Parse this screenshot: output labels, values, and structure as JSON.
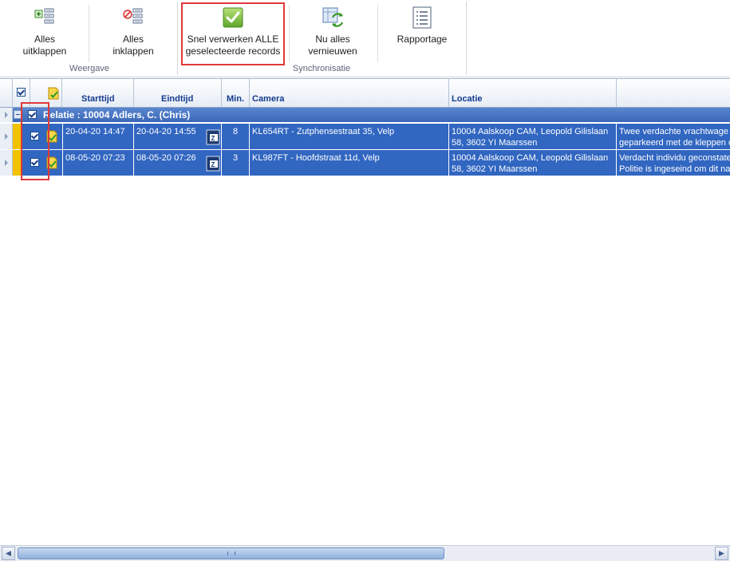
{
  "ribbon": {
    "buttons": {
      "expand_all": "Alles\nuitklappen",
      "collapse_all": "Alles\ninklappen",
      "process_all": "Snel verwerken ALLE\ngeselecteerde records",
      "refresh_all": "Nu alles\nvernieuwen",
      "report": "Rapportage"
    },
    "groups": {
      "view": "Weergave",
      "sync": "Synchronisatie"
    }
  },
  "grid": {
    "columns": {
      "start": "Starttijd",
      "end": "Eindtijd",
      "min": "Min.",
      "camera": "Camera",
      "location": "Locatie"
    },
    "group": {
      "label": "Relatie : 10004 Adlers, C. (Chris)"
    },
    "rows": [
      {
        "start": "20-04-20 14:47",
        "end": "20-04-20 14:55",
        "min": "8",
        "camera": "KL654RT - Zutphensestraat 35, Velp",
        "location_line1": "10004 Aalskoop CAM, Leopold Gilislaan",
        "location_line2": "58, 3602 YI  Maarssen",
        "desc_line1": "Twee verdachte vrachtwage",
        "desc_line2": "geparkeerd met de kleppen o"
      },
      {
        "start": "08-05-20 07:23",
        "end": "08-05-20 07:26",
        "min": "3",
        "camera": "KL987FT - Hoofdstraat 11d, Velp",
        "location_line1": "10004 Aalskoop CAM, Leopold Gilislaan",
        "location_line2": "58, 3602 YI  Maarssen",
        "desc_line1": "Verdacht individu geconstate",
        "desc_line2": "Politie is ingeseind om dit nad"
      }
    ]
  },
  "colors": {
    "selection": "#3166c1",
    "header_text": "#133b8e",
    "highlight_border": "#e0393a",
    "indicator": "#f2c200"
  }
}
